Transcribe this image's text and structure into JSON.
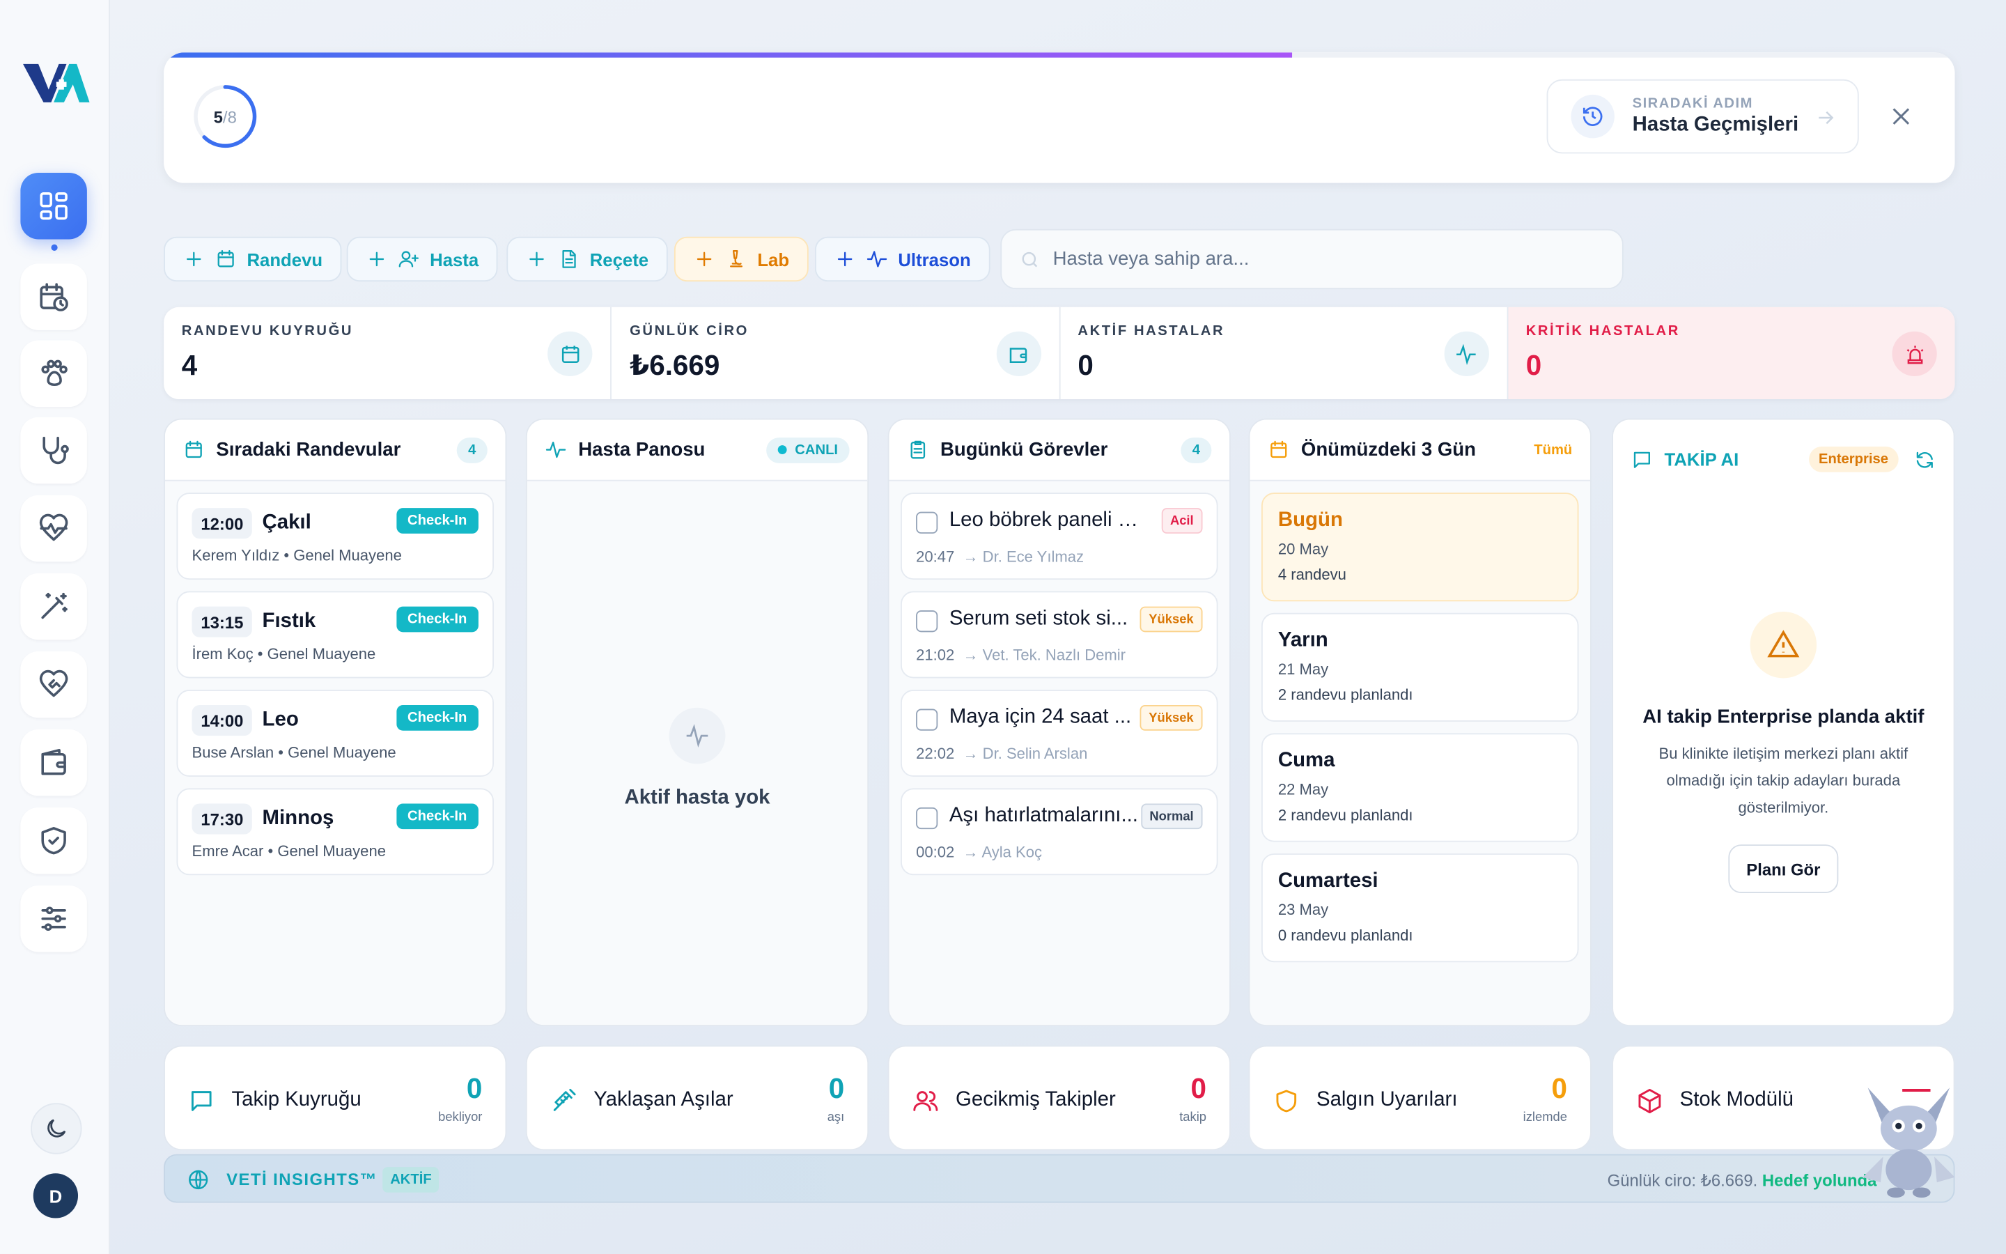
{
  "onboarding": {
    "step_current": "5",
    "step_total": "/8",
    "progress_percent": 63,
    "next_step_label": "SIRADAKİ ADIM",
    "next_step_value": "Hasta Geçmişleri"
  },
  "quick_actions": [
    {
      "label": "Randevu",
      "icon": "calendar-icon"
    },
    {
      "label": "Hasta",
      "icon": "user-plus-icon"
    },
    {
      "label": "Reçete",
      "icon": "document-icon"
    },
    {
      "label": "Lab",
      "icon": "microscope-icon"
    },
    {
      "label": "Ultrason",
      "icon": "pulse-icon"
    }
  ],
  "search": {
    "placeholder": "Hasta veya sahip ara..."
  },
  "stats": [
    {
      "label": "RANDEVU KUYRUĞU",
      "value": "4"
    },
    {
      "label": "GÜNLÜK CİRO",
      "value": "₺6.669"
    },
    {
      "label": "AKTİF HASTALAR",
      "value": "0"
    },
    {
      "label": "KRİTİK HASTALAR",
      "value": "0"
    }
  ],
  "appointments": {
    "title": "Sıradaki Randevular",
    "count": "4",
    "items": [
      {
        "time": "12:00",
        "pet": "Çakıl",
        "sub": "Kerem Yıldız • Genel Muayene",
        "action": "Check-In"
      },
      {
        "time": "13:15",
        "pet": "Fıstık",
        "sub": "İrem Koç • Genel Muayene",
        "action": "Check-In"
      },
      {
        "time": "14:00",
        "pet": "Leo",
        "sub": "Buse Arslan • Genel Muayene",
        "action": "Check-In"
      },
      {
        "time": "17:30",
        "pet": "Minnoş",
        "sub": "Emre Acar • Genel Muayene",
        "action": "Check-In"
      }
    ]
  },
  "patient_board": {
    "title": "Hasta Panosu",
    "live": "CANLI",
    "empty": "Aktif hasta yok"
  },
  "tasks": {
    "title": "Bugünkü Görevler",
    "count": "4",
    "items": [
      {
        "title": "Leo böbrek paneli s...",
        "time": "20:47",
        "who": "→ Dr. Ece Yılmaz",
        "priority": "Acil"
      },
      {
        "title": "Serum seti stok si...",
        "time": "21:02",
        "who": "→ Vet. Tek. Nazlı Demir",
        "priority": "Yüksek"
      },
      {
        "title": "Maya için 24 saat ...",
        "time": "22:02",
        "who": "→ Dr. Selin Arslan",
        "priority": "Yüksek"
      },
      {
        "title": "Aşı hatırlatmalarını...",
        "time": "00:02",
        "who": "→ Ayla Koç",
        "priority": "Normal"
      }
    ]
  },
  "upcoming": {
    "title": "Önümüzdeki 3 Gün",
    "all_link": "Tümü",
    "days": [
      {
        "name": "Bugün",
        "date": "20 May",
        "count": "4 randevu"
      },
      {
        "name": "Yarın",
        "date": "21 May",
        "count": "2 randevu planlandı"
      },
      {
        "name": "Cuma",
        "date": "22 May",
        "count": "2 randevu planlandı"
      },
      {
        "name": "Cumartesi",
        "date": "23 May",
        "count": "0 randevu planlandı"
      }
    ]
  },
  "ai": {
    "title": "TAKİP AI",
    "badge": "Enterprise",
    "heading": "AI takip Enterprise planda aktif",
    "text": "Bu klinikte iletişim merkezi planı aktif olmadığı için takip adayları burada gösterilmiyor.",
    "button": "Planı Gör"
  },
  "bottom_cards": [
    {
      "title": "Takip Kuyruğu",
      "value": "0",
      "unit": "bekliyor",
      "color": "#0fa3b5"
    },
    {
      "title": "Yaklaşan Aşılar",
      "value": "0",
      "unit": "aşı",
      "color": "#0fa3b5"
    },
    {
      "title": "Gecikmiş Takipler",
      "value": "0",
      "unit": "takip",
      "color": "#e11d48"
    },
    {
      "title": "Salgın Uyarıları",
      "value": "0",
      "unit": "izlemde",
      "color": "#f59e0b"
    },
    {
      "title": "Stok Modülü",
      "value": "—",
      "unit": "plan",
      "color": "#e11d48"
    }
  ],
  "insights": {
    "brand": "VETİ INSIGHTS™",
    "badge": "AKTİF",
    "text": "Günlük ciro: ₺6.669.",
    "highlight": "Hedef yolunda"
  },
  "user": {
    "initial": "D"
  },
  "colors": {
    "accent": "#0fa3b5",
    "primary": "#3b6ff0",
    "danger": "#e11d48",
    "warning": "#f59e0b"
  }
}
